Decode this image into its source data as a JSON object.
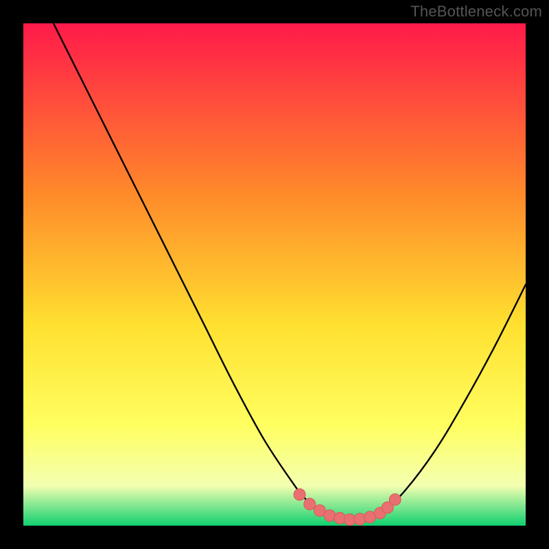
{
  "watermark": "TheBottleneck.com",
  "colors": {
    "frame": "#000000",
    "gradient_top": "#ff1a4a",
    "gradient_mid1": "#ff8a2a",
    "gradient_mid2": "#ffe030",
    "gradient_mid3": "#ffff60",
    "gradient_mid4": "#f4ffb0",
    "gradient_bot": "#10d070",
    "curve": "#000000",
    "marker": "#e87070",
    "marker_stroke": "#d85a5a"
  },
  "chart_data": {
    "type": "line",
    "title": "",
    "xlabel": "",
    "ylabel": "",
    "xlim": [
      0,
      100
    ],
    "ylim": [
      0,
      100
    ],
    "series": [
      {
        "name": "bottleneck-curve",
        "x": [
          6,
          12,
          18,
          24,
          30,
          36,
          42,
          48,
          54,
          56,
          58,
          60,
          62,
          64,
          66,
          68,
          70,
          72,
          76,
          82,
          88,
          94,
          100
        ],
        "y": [
          100,
          88,
          76,
          64,
          52,
          40,
          28,
          17,
          8,
          5.5,
          3.5,
          2.2,
          1.5,
          1.2,
          1.2,
          1.4,
          2,
          3.2,
          7,
          15,
          25,
          36,
          48
        ]
      }
    ],
    "markers": {
      "name": "highlighted-range",
      "x": [
        55,
        57,
        59,
        61,
        63,
        65,
        67,
        69,
        71,
        72.5,
        74
      ],
      "y": [
        6.2,
        4.3,
        3.0,
        2.0,
        1.5,
        1.2,
        1.3,
        1.7,
        2.5,
        3.6,
        5.2
      ]
    }
  }
}
